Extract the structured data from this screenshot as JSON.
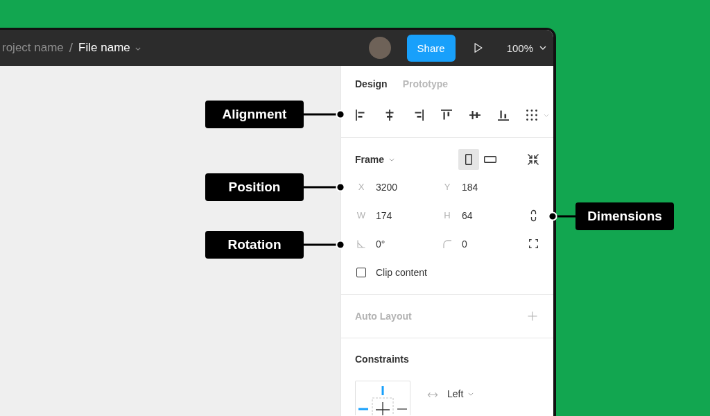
{
  "breadcrumb": {
    "project": "roject name",
    "separator": "/",
    "file": "File name"
  },
  "toolbar": {
    "share": "Share",
    "zoom": "100%"
  },
  "tabs": [
    {
      "label": "Design",
      "selected": true
    },
    {
      "label": "Prototype",
      "selected": false
    }
  ],
  "frame": {
    "title": "Frame",
    "orientations": [
      {
        "kind": "portrait",
        "selected": true
      },
      {
        "kind": "landscape",
        "selected": false
      }
    ],
    "fields": [
      {
        "kind": "letter",
        "label": "X",
        "value": "3200"
      },
      {
        "kind": "letter",
        "label": "Y",
        "value": "184"
      },
      {
        "kind": "letter",
        "label": "W",
        "value": "174"
      },
      {
        "kind": "letter",
        "label": "H",
        "value": "64"
      },
      {
        "kind": "rotation",
        "value": "0°"
      },
      {
        "kind": "radius",
        "value": "0"
      }
    ],
    "clip_content": {
      "label": "Clip content",
      "checked": false
    }
  },
  "auto_layout": {
    "title": "Auto Layout"
  },
  "constraints": {
    "title": "Constraints",
    "pins": [
      {
        "kind": "top",
        "selected": true
      },
      {
        "kind": "left",
        "selected": true
      },
      {
        "kind": "right",
        "selected": false
      }
    ],
    "horizontal": "Left"
  },
  "callouts": [
    {
      "label": "Alignment"
    },
    {
      "label": "Position"
    },
    {
      "label": "Rotation"
    },
    {
      "label": "Dimensions"
    }
  ]
}
